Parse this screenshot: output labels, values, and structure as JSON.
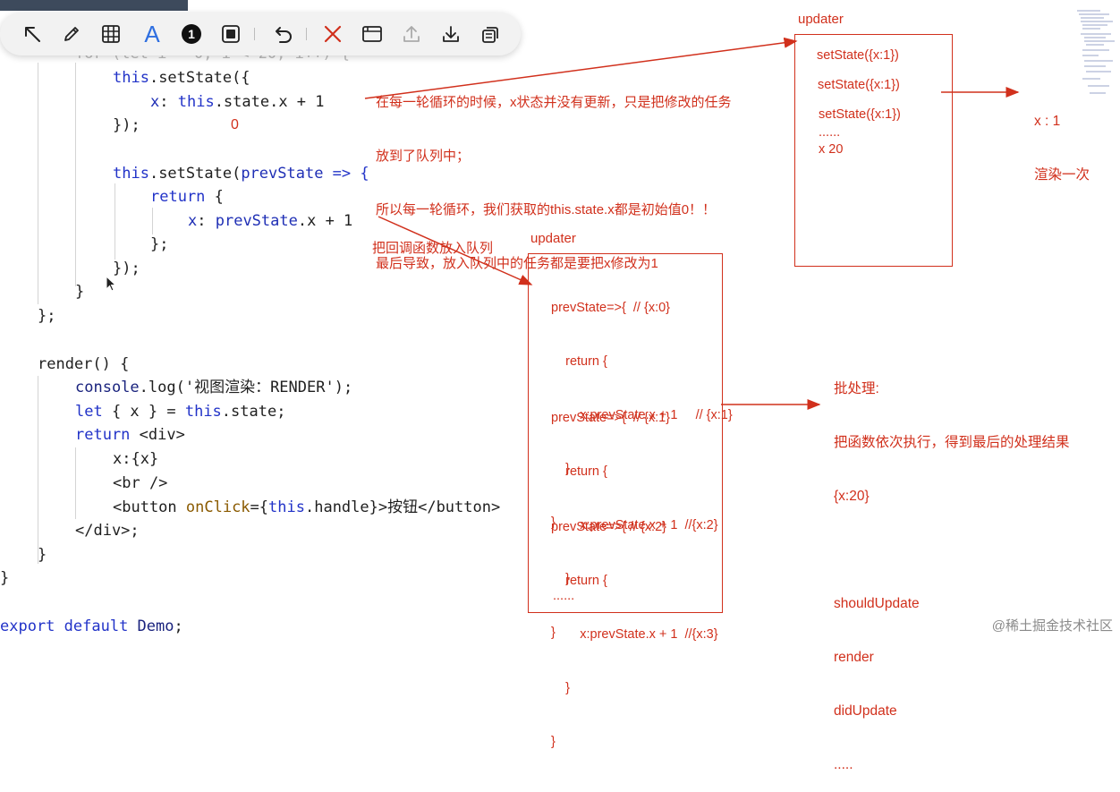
{
  "toolbar": {
    "tools": [
      {
        "name": "select-arrow-icon"
      },
      {
        "name": "pen-icon"
      },
      {
        "name": "grid-icon"
      },
      {
        "name": "text-icon",
        "glyph": "A",
        "accent": "#2f6fe0"
      },
      {
        "name": "number-badge-icon",
        "glyph": "1"
      },
      {
        "name": "frame-icon"
      },
      {
        "name": "undo-icon"
      },
      {
        "name": "close-icon"
      },
      {
        "name": "window-icon"
      },
      {
        "name": "upload-icon"
      },
      {
        "name": "download-icon"
      },
      {
        "name": "copy-icon"
      }
    ]
  },
  "code": {
    "l1": "for (let i = 0; i < 20; i++) {",
    "l2_a": "this",
    "l2_b": ".setState({",
    "l3_a": "x",
    "l3_b": ": ",
    "l3_c": "this",
    "l3_d": ".state.x + 1",
    "l4": "});",
    "l4_zero": "0",
    "l5_a": "this",
    "l5_b": ".setState(",
    "l5_c": "prevState",
    "l5_d": " => {",
    "l6_a": "return",
    "l6_b": " {",
    "l7_a": "x",
    "l7_b": ": ",
    "l7_c": "prevState",
    "l7_d": ".x + 1",
    "l8": "};",
    "l9": "});",
    "l10": "}",
    "l11": "};",
    "l12": "render() {",
    "l13_a": "console",
    "l13_b": ".log('视图渲染：RENDER');",
    "l14_a": "let",
    "l14_b": " { x } = ",
    "l14_c": "this",
    "l14_d": ".state;",
    "l15_a": "return",
    "l15_b": " <div>",
    "l16": "x:{x}",
    "l17": "<br />",
    "l18_a": "<button ",
    "l18_b": "onClick",
    "l18_c": "={",
    "l18_d": "this",
    "l18_e": ".handle}>按钮</button>",
    "l19": "</div>;",
    "l20": "}",
    "l21": "}",
    "l22_a": "export",
    "l22_b": " default ",
    "l22_c": "Demo",
    "l22_d": ";"
  },
  "annotations": {
    "note1_line1": "在每一轮循环的时候，x状态并没有更新，只是把修改的任务",
    "note1_line2": "放到了队列中；",
    "note1_line3": "所以每一轮循环，我们获取的this.state.x都是初始值0！！",
    "note1_line4": "最后导致，放入队列中的任务都是要把x修改为1",
    "note2": "把回调函数放入队列",
    "batch_title": "批处理:",
    "batch_line1": "把函数依次执行，得到最后的处理结果",
    "batch_line2": "{x:20}",
    "batch_line3": "shouldUpdate",
    "batch_line4": "render",
    "batch_line5": "didUpdate",
    "batch_line6": ".....",
    "result_line1": "x : 1",
    "result_line2": "渲染一次"
  },
  "updater1": {
    "title": "updater",
    "items": [
      "setState({x:1})",
      "setState({x:1})",
      "setState({x:1})",
      "......",
      "x 20"
    ]
  },
  "updater2": {
    "title": "updater",
    "b1": [
      "prevState=>{  // {x:0}",
      "    return {",
      "        x:prevState.x + 1     // {x:1}",
      "    }",
      "}"
    ],
    "b2": [
      "prevState=>{  // {x:1}",
      "    return {",
      "        x:prevState.x + 1  //{x:2}",
      "    }",
      "}"
    ],
    "b3": [
      "prevState=>{ // {x:2}",
      "    return {",
      "        x:prevState.x + 1  //{x:3}",
      "    }",
      "}"
    ],
    "more": "......"
  },
  "watermark": "@稀土掘金技术社区",
  "colors": {
    "annotation": "#d1301c",
    "keyword": "#2233c8",
    "toolbar_bg": "#f2f2f2"
  }
}
